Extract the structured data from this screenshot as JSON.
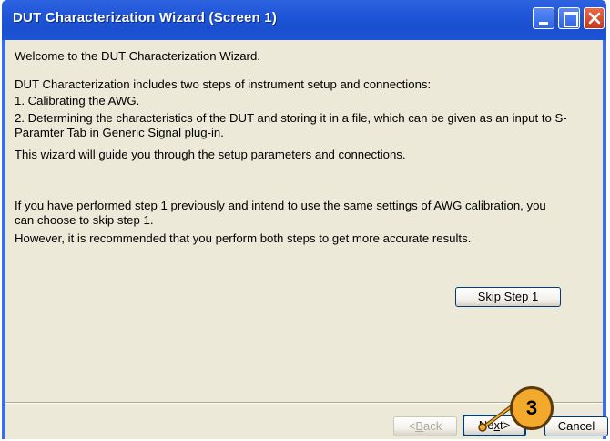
{
  "window": {
    "title": "DUT Characterization Wizard (Screen 1)",
    "accent_color": "#1f55d8"
  },
  "content": {
    "welcome": "Welcome to the DUT Characterization Wizard.",
    "intro": "DUT Characterization includes two steps of instrument setup and connections:",
    "step1": "1. Calibrating the AWG.",
    "step2": "2. Determining the characteristics of the DUT and storing it in a file, which can be given as an input to S-Paramter Tab in Generic Signal plug-in.",
    "guide": "This wizard will guide you through the setup parameters and connections.",
    "skip_note": "If you have performed step 1 previously and intend to use the same settings of AWG calibration, you can choose to skip step 1.",
    "recommend": "However, it is recommended that you perform both steps to get more accurate results."
  },
  "buttons": {
    "skip": "Skip Step 1",
    "back_prefix": "<",
    "back_underline": "B",
    "back_rest": "ack",
    "next_prefix": "Ne",
    "next_underline": "x",
    "next_rest": "t>",
    "cancel": "Cancel"
  },
  "callout": {
    "number": "3",
    "color": "#f3a92b"
  }
}
